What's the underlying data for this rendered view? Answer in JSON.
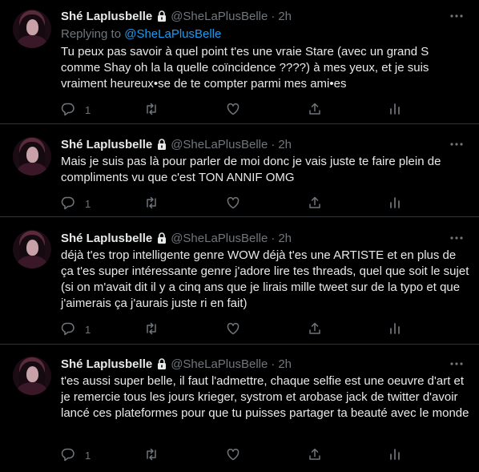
{
  "tweets": [
    {
      "name": "Shé Laplusbelle",
      "handle": "@SheLaPlusBelle",
      "time": "2h",
      "replying_prefix": "Replying to ",
      "replying_to": "@SheLaPlusBelle",
      "text": "Tu peux pas savoir à quel point t'es une vraie Stare (avec un grand S comme Shay oh la la quelle coïncidence ????) à mes yeux, et je suis vraiment heureux•se de te compter parmi mes ami•es",
      "reply_count": "1"
    },
    {
      "name": "Shé Laplusbelle",
      "handle": "@SheLaPlusBelle",
      "time": "2h",
      "text": "Mais je suis pas là pour parler de moi donc je vais juste te faire plein de compliments vu que c'est TON ANNIF OMG",
      "reply_count": "1"
    },
    {
      "name": "Shé Laplusbelle",
      "handle": "@SheLaPlusBelle",
      "time": "2h",
      "text": "déjà t'es trop intelligente genre WOW déjà t'es une ARTISTE et en plus de ça t'es super intéressante genre j'adore lire tes threads, quel que soit le sujet (si on m'avait dit il y a cinq ans que je lirais mille tweet sur de la typo et que j'aimerais ça j'aurais juste ri en fait)",
      "reply_count": "1"
    },
    {
      "name": "Shé Laplusbelle",
      "handle": "@SheLaPlusBelle",
      "time": "2h",
      "text": "t'es aussi super belle, il faut l'admettre, chaque selfie est une oeuvre d'art et je remercie tous les jours krieger, systrom et arobase jack de twitter d'avoir lancé ces plateformes pour que tu puisses partager ta beauté avec le monde",
      "reply_count": "1"
    }
  ],
  "separator": "·",
  "colors": {
    "background": "#000000",
    "text": "#e7e9ea",
    "muted": "#71767b",
    "link": "#1d9bf0",
    "border": "#2f3336"
  },
  "icons": [
    "lock-icon",
    "more-icon",
    "reply-icon",
    "retweet-icon",
    "like-icon",
    "share-icon",
    "analytics-icon"
  ]
}
